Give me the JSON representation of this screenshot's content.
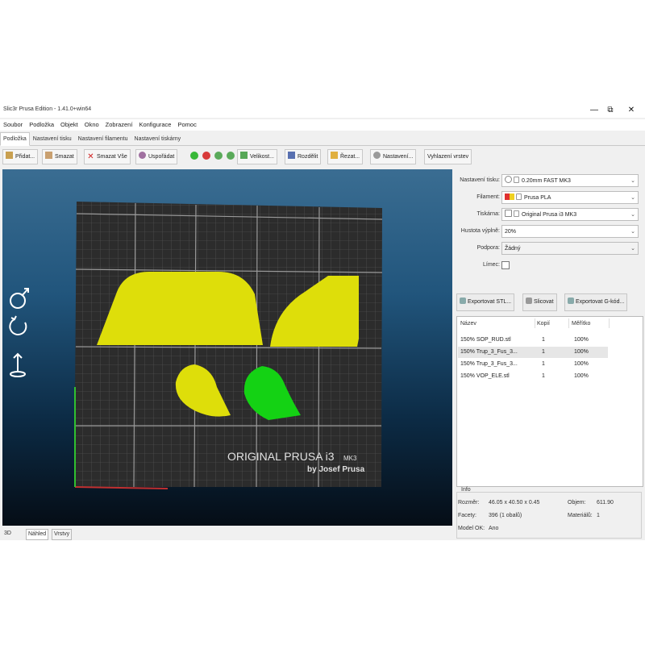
{
  "window": {
    "title": "Slic3r Prusa Edition - 1.41.0+win64",
    "controls": [
      "—",
      "⧉",
      "✕"
    ]
  },
  "menubar": [
    "Soubor",
    "Podložka",
    "Objekt",
    "Okno",
    "Zobrazení",
    "Konfigurace",
    "Pomoc"
  ],
  "tabs": [
    {
      "label": "Podložka",
      "active": true
    },
    {
      "label": "Nastavení tisku",
      "active": false
    },
    {
      "label": "Nastavení filamentu",
      "active": false
    },
    {
      "label": "Nastavení tiskárny",
      "active": false
    }
  ],
  "toolbar": {
    "add": "Přidat...",
    "delete": "Smazat",
    "delete_all": "Smazat Vše",
    "arrange": "Uspořádat",
    "scale": "Velikost...",
    "split": "Rozdělit",
    "cut": "Řezat...",
    "settings": "Nastavení...",
    "layer_editing": "Vyhlazení vrstev"
  },
  "viewport": {
    "bed_logo_line1": "ORIGINAL PRUSA i3",
    "bed_logo_model": "MK3",
    "bed_logo_line2": "by Josef Prusa",
    "object_colors": {
      "normal": "#dede0a",
      "selected": "#14d214"
    }
  },
  "bottom_tabs": [
    "3D",
    "Náhled",
    "Vrstvy"
  ],
  "settings": {
    "print_label": "Nastavení tisku:",
    "print_value": "0.20mm FAST MK3",
    "filament_label": "Filament:",
    "filament_value": "Prusa PLA",
    "filament_color": "#e03030",
    "printer_label": "Tiskárna:",
    "printer_value": "Original Prusa i3 MK3",
    "infill_label": "Hustota výplně:",
    "infill_value": "20%",
    "support_label": "Podpora:",
    "support_value": "Žádný",
    "brim_label": "Límec:"
  },
  "buttons": {
    "export_stl": "Exportovat STL...",
    "slice": "Slicovat",
    "export_gcode": "Exportovat G-kód..."
  },
  "object_list": {
    "headers": {
      "name": "Název",
      "copies": "Kopií",
      "scale": "Měřítko"
    },
    "rows": [
      {
        "name": "150% SOP_RUD.stl",
        "copies": "1",
        "scale": "100%"
      },
      {
        "name": "150% Trup_3_Fus_3...",
        "copies": "1",
        "scale": "100%"
      },
      {
        "name": "150% Trup_3_Fus_3...",
        "copies": "1",
        "scale": "100%"
      },
      {
        "name": "150% VOP_ELE.stl",
        "copies": "1",
        "scale": "100%"
      }
    ]
  },
  "info": {
    "heading": "Info",
    "size_label": "Rozměr:",
    "size_value": "46.05 x 40.50 x 0.45",
    "volume_label": "Objem:",
    "volume_value": "611.90",
    "facets_label": "Facety:",
    "facets_value": "396 (1 obalů)",
    "materials_label": "Materiálů:",
    "materials_value": "1",
    "model_ok_label": "Model OK:",
    "model_ok_value": "Ano"
  }
}
